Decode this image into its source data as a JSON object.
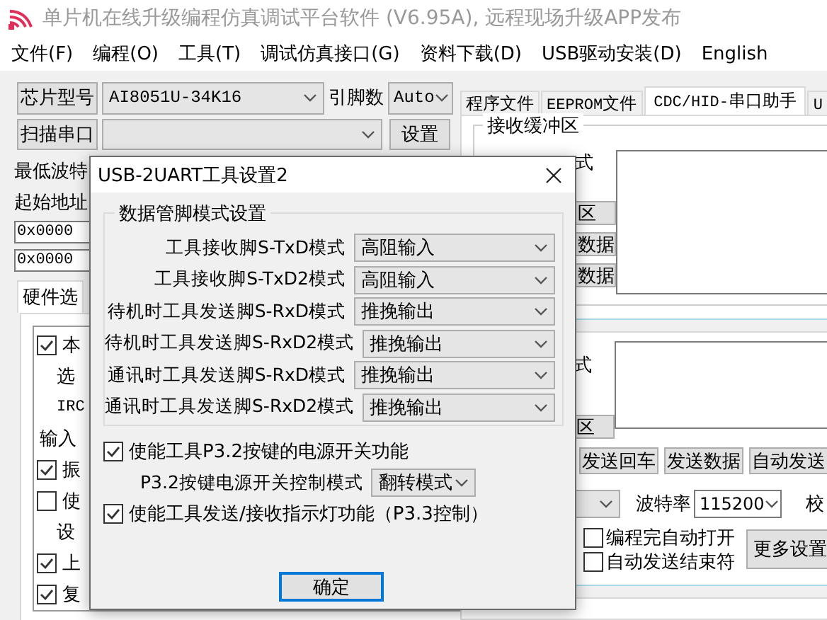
{
  "window": {
    "title": "单片机在线升级编程仿真调试平台软件 (V6.95A), 远程现场升级APP发布"
  },
  "menu": [
    "文件(F)",
    "编程(O)",
    "工具(T)",
    "调试仿真接口(G)",
    "资料下载(D)",
    "USB驱动安装(D)",
    "English"
  ],
  "toolbar": {
    "chip_button": "芯片型号",
    "chip_value": "AI8051U-34K16",
    "pins_label": "引脚数",
    "pins_value": "Auto",
    "scan_button": "扫描串口",
    "settings_button": "设置"
  },
  "tabs": [
    {
      "label": "程序文件",
      "selected": false
    },
    {
      "label": "EEPROM文件",
      "selected": false
    },
    {
      "label": "CDC/HID-串口助手",
      "selected": true
    },
    {
      "label": "U",
      "selected": false
    }
  ],
  "left_panel": {
    "baud_label": "最低波特",
    "start_address_label": "起始地址",
    "address_fields": [
      "0x0000",
      "0x0000"
    ],
    "hardware_tab": "硬件选",
    "options": [
      {
        "kind": "checkbox",
        "label": "本",
        "checked": true
      },
      {
        "kind": "text",
        "label": "选"
      },
      {
        "kind": "text",
        "label": "IRC"
      },
      {
        "kind": "heading",
        "label": "输入"
      },
      {
        "kind": "checkbox",
        "label": "振",
        "checked": true
      },
      {
        "kind": "checkbox",
        "label": "使",
        "checked": false
      },
      {
        "kind": "text",
        "label": "设"
      },
      {
        "kind": "checkbox",
        "label": "上",
        "checked": true
      },
      {
        "kind": "checkbox",
        "label": "复",
        "checked": true
      }
    ]
  },
  "receive": {
    "group_title": "接收缓冲区",
    "mode_fragment": "式",
    "buttons": [
      "区",
      "数据",
      "数据"
    ]
  },
  "send": {
    "mode_fragment": "式",
    "buttons": [
      "区"
    ],
    "actions": [
      "发送回车",
      "发送数据",
      "自动发送"
    ],
    "baud_label": "波特率",
    "baud_value": "115200",
    "parity_label": "校",
    "checks": [
      {
        "label": "编程完自动打开",
        "checked": false
      },
      {
        "label": "自动发送结束符",
        "checked": false
      }
    ],
    "more_button": "更多设置"
  },
  "dialog": {
    "title": "USB-2UART工具设置2",
    "group_title": "数据管脚模式设置",
    "pin_modes": [
      {
        "label": "工具接收脚S-TxD模式",
        "value": "高阻输入"
      },
      {
        "label": "工具接收脚S-TxD2模式",
        "value": "高阻输入"
      },
      {
        "label": "待机时工具发送脚S-RxD模式",
        "value": "推挽输出"
      },
      {
        "label": "待机时工具发送脚S-RxD2模式",
        "value": "推挽输出"
      },
      {
        "label": "通讯时工具发送脚S-RxD模式",
        "value": "推挽输出"
      },
      {
        "label": "通讯时工具发送脚S-RxD2模式",
        "value": "推挽输出"
      }
    ],
    "options": [
      {
        "kind": "checkbox",
        "label": "使能工具P3.2按键的电源开关功能",
        "checked": true
      },
      {
        "kind": "select",
        "label": "P3.2按键电源开关控制模式",
        "value": "翻转模式"
      },
      {
        "kind": "checkbox",
        "label": "使能工具发送/接收指示灯功能（P3.3控制）",
        "checked": true
      }
    ],
    "ok_button": "确定"
  }
}
